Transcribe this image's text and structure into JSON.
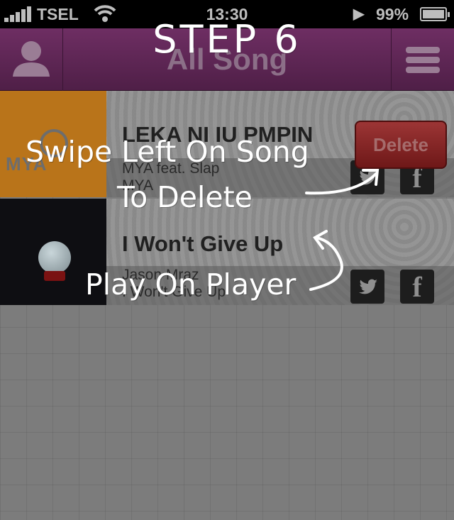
{
  "status_bar": {
    "carrier": "TSEL",
    "time": "13:30",
    "battery_percent": "99%"
  },
  "nav": {
    "title": "All Song",
    "left_icon": "user-icon",
    "right_icon": "menu-icon"
  },
  "songs": [
    {
      "title": "LEKA NI IU PMPIN",
      "artist": "MYA feat. Slap",
      "album": "MYA",
      "art_text": "MYA",
      "delete_label": "Delete"
    },
    {
      "title": "I Won't Give Up",
      "artist": "Jason Mraz",
      "album": "I Won't Give Up"
    }
  ],
  "overlay": {
    "step": "STEP 6",
    "swipe_line1": "Swipe Left On Song",
    "swipe_line2": "To Delete",
    "play": "Play On Player"
  },
  "colors": {
    "nav_bar": "#5e2755",
    "delete_button": "#8a2a2a",
    "overlay_text": "#ffffff"
  }
}
